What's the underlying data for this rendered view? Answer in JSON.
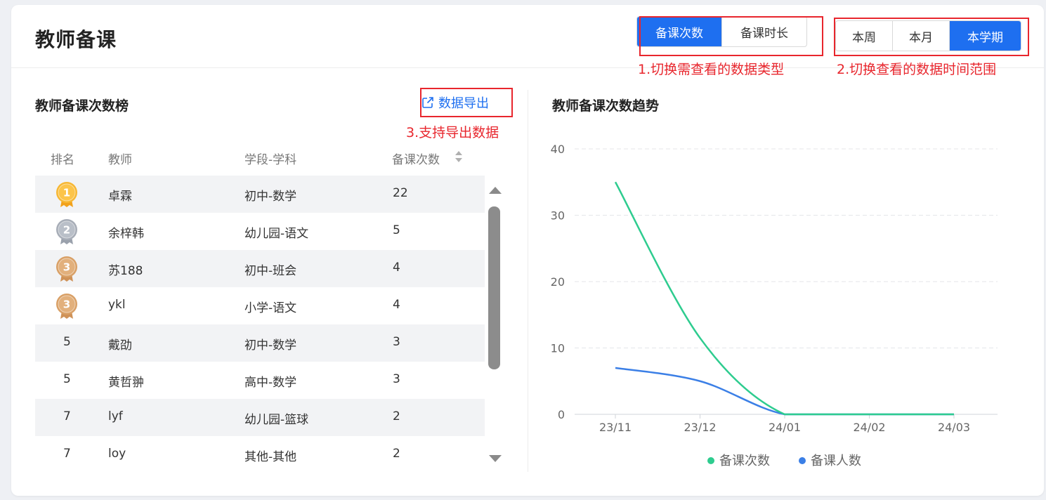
{
  "header": {
    "title": "教师备课"
  },
  "metric_toggle": {
    "options": [
      "备课次数",
      "备课时长"
    ],
    "active": 0
  },
  "range_toggle": {
    "options": [
      "本周",
      "本月",
      "本学期"
    ],
    "active": 2
  },
  "annotations": {
    "a1": "1.切换需查看的数据类型",
    "a2": "2.切换查看的数据时间范围",
    "a3": "3.支持导出数据"
  },
  "ranking": {
    "title": "教师备课次数榜",
    "export_label": "数据导出",
    "columns": [
      "排名",
      "教师",
      "学段-学科",
      "备课次数"
    ],
    "rows": [
      {
        "rank": "1",
        "medal": "gold",
        "teacher": "卓霖",
        "subject": "初中-数学",
        "count": "22"
      },
      {
        "rank": "2",
        "medal": "silver",
        "teacher": "余梓韩",
        "subject": "幼儿园-语文",
        "count": "5"
      },
      {
        "rank": "3",
        "medal": "bronze",
        "teacher": "苏188",
        "subject": "初中-班会",
        "count": "4"
      },
      {
        "rank": "3",
        "medal": "bronze",
        "teacher": "ykl",
        "subject": "小学-语文",
        "count": "4"
      },
      {
        "rank": "5",
        "medal": "",
        "teacher": "戴劭",
        "subject": "初中-数学",
        "count": "3"
      },
      {
        "rank": "5",
        "medal": "",
        "teacher": "黄哲翀",
        "subject": "高中-数学",
        "count": "3"
      },
      {
        "rank": "7",
        "medal": "",
        "teacher": "lyf",
        "subject": "幼儿园-篮球",
        "count": "2"
      },
      {
        "rank": "7",
        "medal": "",
        "teacher": "loy",
        "subject": "其他-其他",
        "count": "2"
      }
    ]
  },
  "trend": {
    "title": "教师备课次数趋势"
  },
  "chart_data": {
    "type": "line",
    "x": [
      "23/11",
      "23/12",
      "24/01",
      "24/02",
      "24/03"
    ],
    "series": [
      {
        "name": "备课次数",
        "color": "#2ecc8f",
        "values": [
          35,
          11.5,
          0,
          0,
          0
        ]
      },
      {
        "name": "备课人数",
        "color": "#3b7fe6",
        "values": [
          7,
          5,
          0,
          0,
          0
        ]
      }
    ],
    "ylim": [
      0,
      40
    ],
    "yticks": [
      0,
      10,
      20,
      30,
      40
    ],
    "grid": true,
    "legend": "bottom-center"
  },
  "colors": {
    "primary": "#1e6ff0",
    "annotation": "#e8262d"
  }
}
